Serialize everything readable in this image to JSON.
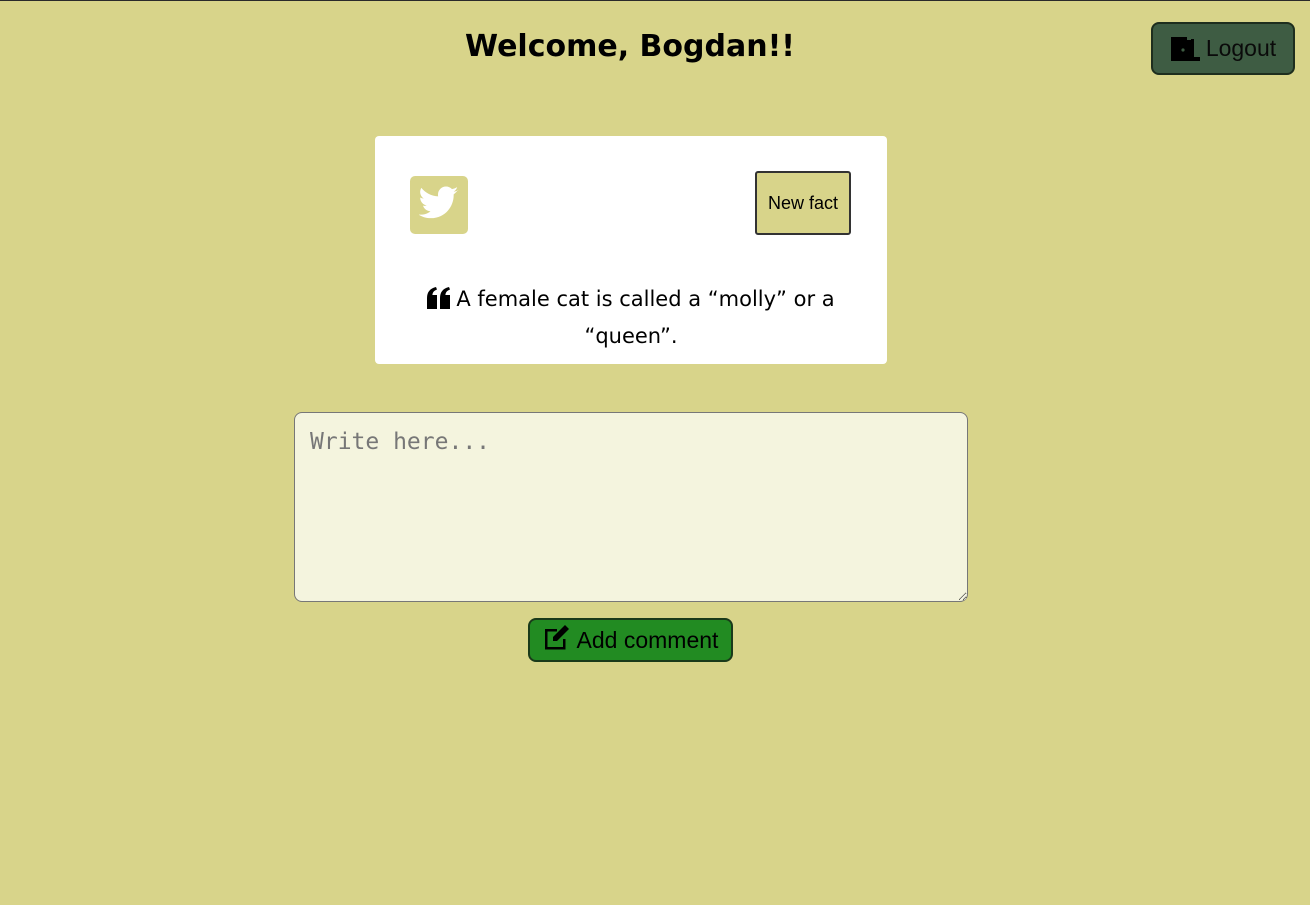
{
  "header": {
    "welcome": "Welcome, Bogdan!!",
    "logout_label": "Logout",
    "logout_icon": "door-icon"
  },
  "fact_card": {
    "share_icon": "twitter-icon",
    "new_fact_label": "New fact",
    "quote_icon": "quote-left-icon",
    "fact_text": "A female cat is called a “molly” or a “queen”."
  },
  "comment": {
    "placeholder": "Write here...",
    "value": "",
    "add_label": "Add comment",
    "add_icon": "edit-icon"
  },
  "colors": {
    "background": "#d8d48a",
    "logout_button": "#3e5c43",
    "add_button": "#228b22",
    "card": "#ffffff",
    "textarea": "#f4f4de"
  }
}
